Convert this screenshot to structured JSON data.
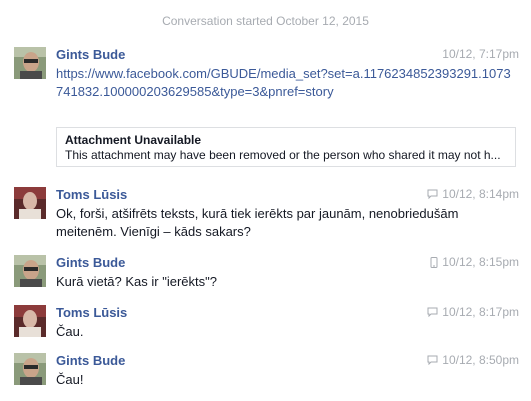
{
  "conversation": {
    "started_label": "Conversation started October 12, 2015"
  },
  "messages": [
    {
      "sender": "Gints Bude",
      "time": "10/12, 7:17pm",
      "source_icon": "",
      "link": "https://www.facebook.com/GBUDE/media_set?set=a.1176234852393291.1073741832.100000203629585&type=3&pnref=story",
      "attachment": {
        "title": "Attachment Unavailable",
        "description": "This attachment may have been removed or the person who shared it may not h..."
      }
    },
    {
      "sender": "Toms Lūsis",
      "time": "10/12, 8:14pm",
      "source_icon": "chat-bubble-icon",
      "text": "Ok, forši, atšifrēts teksts, kurā tiek ierēkts par jaunām, nenobriedušām meitenēm. Vienīgi – kāds sakars?"
    },
    {
      "sender": "Gints Bude",
      "time": "10/12, 8:15pm",
      "source_icon": "mobile-phone-icon",
      "text": "Kurā vietā? Kas ir \"ierēkts\"?"
    },
    {
      "sender": "Toms Lūsis",
      "time": "10/12, 8:17pm",
      "source_icon": "chat-bubble-icon",
      "text": "Čau."
    },
    {
      "sender": "Gints Bude",
      "time": "10/12, 8:50pm",
      "source_icon": "chat-bubble-icon",
      "text": "Čau!"
    }
  ],
  "colors": {
    "name": "#3b5998",
    "link": "#3b5998",
    "meta": "#a7abb1",
    "text": "#141823"
  }
}
